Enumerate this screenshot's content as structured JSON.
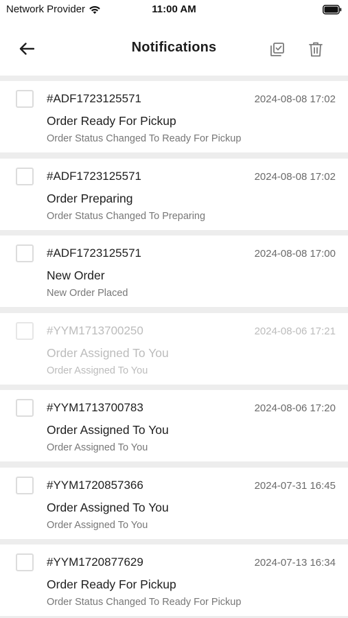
{
  "status_bar": {
    "carrier": "Network Provider",
    "time": "11:00 AM"
  },
  "header": {
    "title": "Notifications"
  },
  "notifications": [
    {
      "order_id": "#ADF1723125571",
      "date": "2024-08-08 17:02",
      "title": "Order Ready For Pickup",
      "description": "Order Status Changed To Ready For Pickup",
      "muted": false
    },
    {
      "order_id": "#ADF1723125571",
      "date": "2024-08-08 17:02",
      "title": "Order Preparing",
      "description": "Order Status Changed To Preparing",
      "muted": false
    },
    {
      "order_id": "#ADF1723125571",
      "date": "2024-08-08 17:00",
      "title": "New Order",
      "description": "New Order Placed",
      "muted": false
    },
    {
      "order_id": "#YYM1713700250",
      "date": "2024-08-06 17:21",
      "title": "Order Assigned To You",
      "description": "Order Assigned To You",
      "muted": true
    },
    {
      "order_id": "#YYM1713700783",
      "date": "2024-08-06 17:20",
      "title": "Order Assigned To You",
      "description": "Order Assigned To You",
      "muted": false
    },
    {
      "order_id": "#YYM1720857366",
      "date": "2024-07-31 16:45",
      "title": "Order Assigned To You",
      "description": "Order Assigned To You",
      "muted": false
    },
    {
      "order_id": "#YYM1720877629",
      "date": "2024-07-13 16:34",
      "title": "Order Ready For Pickup",
      "description": "Order Status Changed To Ready For Pickup",
      "muted": false
    }
  ]
}
